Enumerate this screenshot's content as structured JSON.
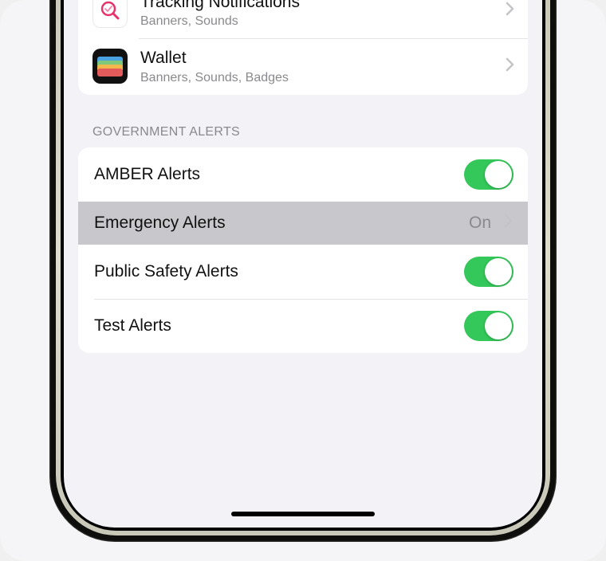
{
  "apps": [
    {
      "title": "Tracking Notifications",
      "subtitle": "Banners, Sounds",
      "icon": "tracking",
      "name": "app-row-tracking-notifications"
    },
    {
      "title": "Wallet",
      "subtitle": "Banners, Sounds, Badges",
      "icon": "wallet",
      "name": "app-row-wallet"
    }
  ],
  "gov_header": "GOVERNMENT ALERTS",
  "gov_alerts": {
    "amber": {
      "label": "AMBER Alerts",
      "on": true
    },
    "emergency": {
      "label": "Emergency Alerts",
      "value": "On"
    },
    "public_safety": {
      "label": "Public Safety Alerts",
      "on": true
    },
    "test": {
      "label": "Test Alerts",
      "on": true
    }
  }
}
